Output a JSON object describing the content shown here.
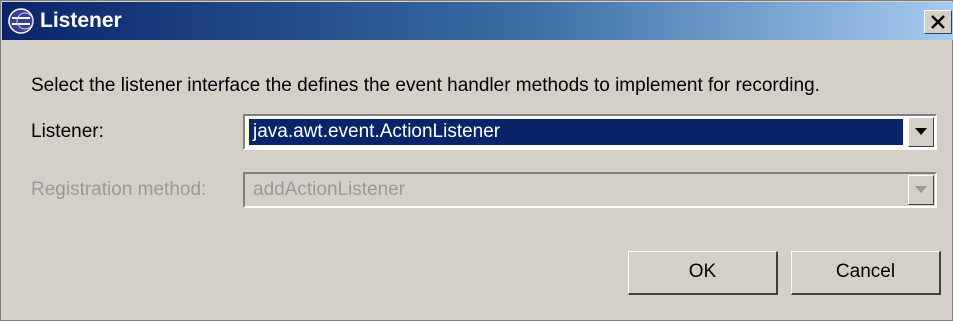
{
  "window": {
    "title": "Listener",
    "icon": "eclipse-app-icon",
    "close_icon": "close-icon"
  },
  "instruction": "Select the listener interface the defines the event handler methods to implement for recording.",
  "listener": {
    "label": "Listener:",
    "value": "java.awt.event.ActionListener",
    "selected": true,
    "enabled": true
  },
  "registration": {
    "label": "Registration method:",
    "value": "addActionListener",
    "enabled": false
  },
  "buttons": {
    "ok": "OK",
    "cancel": "Cancel"
  },
  "colors": {
    "title_bar_start": "#0a246a",
    "title_bar_end": "#a6caf0",
    "dialog_bg": "#d4d0c8",
    "selection_bg": "#0a246a",
    "disabled_text": "#9a9a9a"
  }
}
